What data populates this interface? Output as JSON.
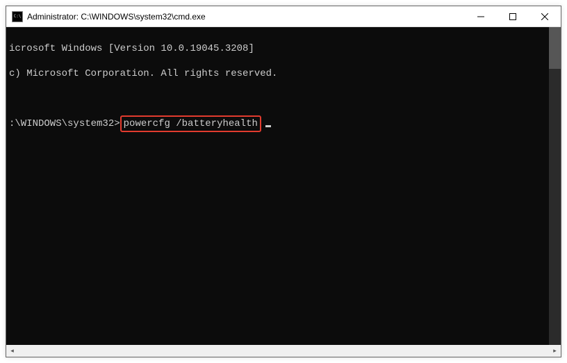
{
  "window": {
    "title": "Administrator: C:\\WINDOWS\\system32\\cmd.exe"
  },
  "terminal": {
    "line1": "icrosoft Windows [Version 10.0.19045.3208]",
    "line2": "c) Microsoft Corporation. All rights reserved.",
    "prompt": ":\\WINDOWS\\system32>",
    "command": "powercfg /batteryhealth"
  }
}
